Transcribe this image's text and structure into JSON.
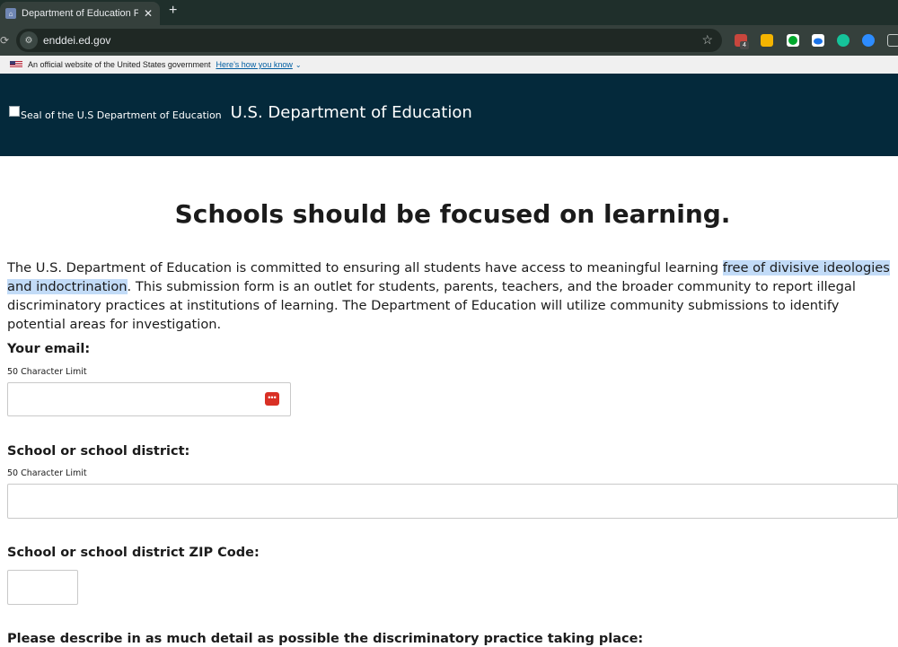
{
  "browser": {
    "tab_title": "Department of Education For",
    "tab_close": "✕",
    "new_tab": "+",
    "url": "enddei.ed.gov",
    "star": "☆",
    "extension_badge": "4",
    "extensions": [
      "calendar-extension-icon",
      "notes-extension-icon",
      "evernote-extension-icon",
      "cloud-extension-icon",
      "grammarly-extension-icon",
      "zoom-extension-icon"
    ]
  },
  "gov_banner": {
    "text": "An official website of the United States government",
    "link": "Here’s how you know",
    "chevron": "⌄"
  },
  "header": {
    "seal_alt": "Seal of the U.S Department of Education",
    "agency": "U.S. Department of Education",
    "bg_color": "#04293b"
  },
  "main": {
    "headline": "Schools should be focused on learning.",
    "intro_part1": "The U.S. Department of Education is committed to ensuring all students have access to meaningful learning ",
    "intro_highlight": "free of divisive ideologies and indoctrination",
    "intro_part2": ". This submission form is an outlet for students, parents, teachers, and the broader community to report illegal discriminatory practices at institutions of learning. The Department of Education will utilize community submissions to identify potential areas for investigation."
  },
  "form": {
    "email_label": "Your email:",
    "email_limit": "50 Character Limit",
    "email_value": "",
    "district_label": "School or school district:",
    "district_limit": "50 Character Limit",
    "district_value": "",
    "zip_label": "School or school district ZIP Code:",
    "zip_value": "",
    "description_label": "Please describe in as much detail as possible the discriminatory practice taking place:"
  }
}
